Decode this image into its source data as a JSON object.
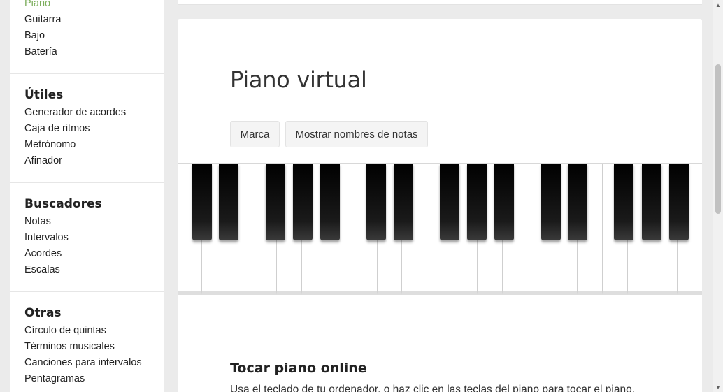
{
  "sidebar": {
    "groups": [
      {
        "title": "",
        "items": [
          "Piano",
          "Guitarra",
          "Bajo",
          "Batería"
        ],
        "active": 0
      },
      {
        "title": "Útiles",
        "items": [
          "Generador de acordes",
          "Caja de ritmos",
          "Metrónomo",
          "Afinador"
        ]
      },
      {
        "title": "Buscadores",
        "items": [
          "Notas",
          "Intervalos",
          "Acordes",
          "Escalas"
        ]
      },
      {
        "title": "Otras",
        "items": [
          "Círculo de quintas",
          "Términos musicales",
          "Canciones para intervalos",
          "Pentagramas"
        ]
      }
    ]
  },
  "main": {
    "title": "Piano virtual",
    "buttons": {
      "mark": "Marca",
      "show_names": "Mostrar nombres de notas"
    },
    "piano": {
      "white_keys": 21,
      "black_keys": 15
    },
    "section": {
      "title": "Tocar piano online",
      "text": "Usa el teclado de tu ordenador, o haz clic en las teclas del piano para tocar el piano."
    }
  },
  "colors": {
    "accent": "#7bad5b",
    "page_bg": "#ebebeb"
  },
  "icons": {
    "scroll_up": "triangle-up-icon",
    "scroll_down": "triangle-down-icon"
  }
}
